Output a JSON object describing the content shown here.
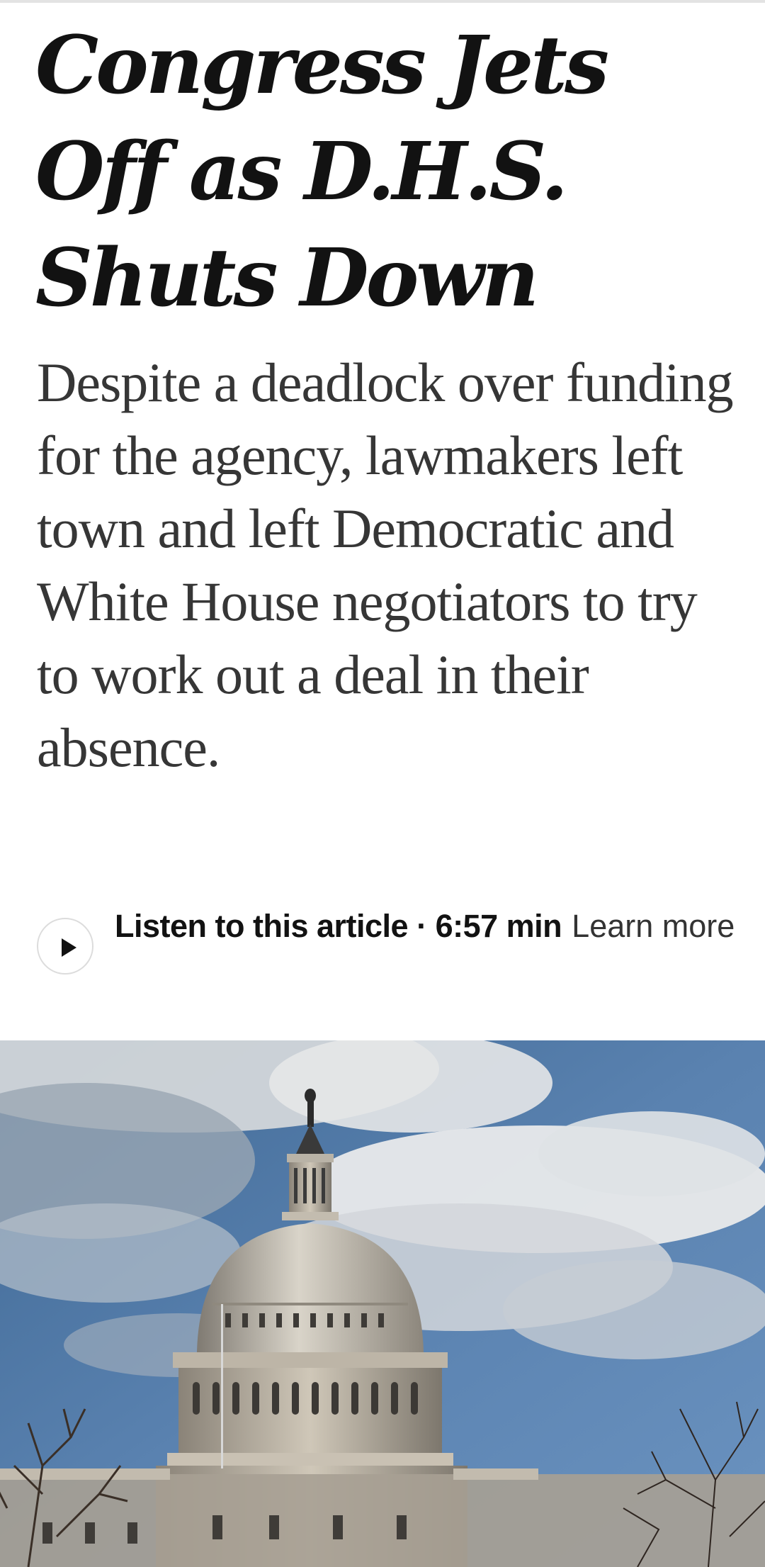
{
  "article": {
    "headline": "Congress Jets Off as D.H.S. Shuts Down",
    "summary": "Despite a deadlock over funding for the agency, lawmakers left town and left Democratic and White House negotiators to try to work out a deal in their absence.",
    "listen": {
      "label": "Listen to this article",
      "separator": " · ",
      "duration": "6:57 min",
      "learn_more": "Learn more"
    }
  },
  "icons": {
    "play": "play-icon"
  },
  "colors": {
    "text": "#121212",
    "summary": "#363636",
    "sky": "#4f79a8",
    "cloud": "#e4e5e6"
  }
}
